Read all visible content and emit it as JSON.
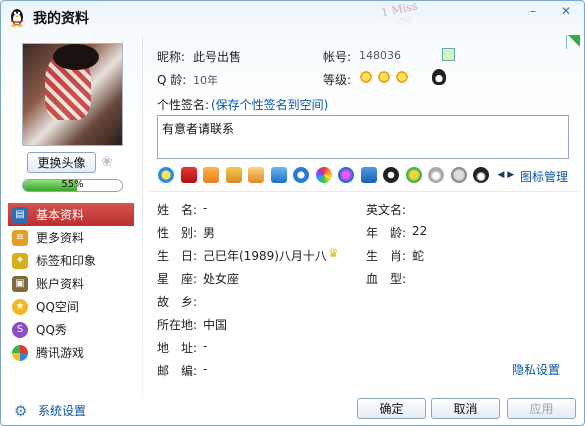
{
  "window": {
    "title": "我的资料",
    "watermark": "Miss",
    "watermark_digit": "1",
    "minimize_glyph": "–",
    "close_glyph": "✕"
  },
  "left": {
    "change_avatar_label": "更换头像",
    "completion": {
      "percent": 55,
      "label": "55%"
    },
    "nav": [
      {
        "label": "基本资料",
        "icon": "basic-info-icon",
        "active": true
      },
      {
        "label": "更多资料",
        "icon": "more-info-icon",
        "active": false
      },
      {
        "label": "标签和印象",
        "icon": "tags-impression-icon",
        "active": false
      },
      {
        "label": "账户资料",
        "icon": "account-info-icon",
        "active": false
      },
      {
        "label": "QQ空间",
        "icon": "qzone-icon",
        "active": false
      },
      {
        "label": "QQ秀",
        "icon": "qqshow-icon",
        "active": false
      },
      {
        "label": "腾讯游戏",
        "icon": "tencent-games-icon",
        "active": false
      }
    ],
    "settings_label": "系统设置"
  },
  "profile": {
    "nickname_label": "昵称:",
    "nickname_value": "此号出售",
    "account_label": "帐号:",
    "account_value": "148036",
    "qage_label": "Q 龄:",
    "qage_value": "10年",
    "level_label": "等级:",
    "signature_label": "个性签名:",
    "signature_link": "(保存个性签名到空间)",
    "signature_text": "有意者请联系",
    "icon_manage_label": "图标管理"
  },
  "details": {
    "left": [
      {
        "label": "姓　名:",
        "value": "-"
      },
      {
        "label": "性　别:",
        "value": "男"
      },
      {
        "label": "生　日:",
        "value": "己巳年(1989)八月十八"
      },
      {
        "label": "星　座:",
        "value": "处女座"
      },
      {
        "label": "故　乡:",
        "value": ""
      },
      {
        "label": "所在地:",
        "value": "中国"
      },
      {
        "label": "地　址:",
        "value": "-"
      },
      {
        "label": "邮　编:",
        "value": "-"
      }
    ],
    "right": [
      {
        "label": "英文名:",
        "value": ""
      },
      {
        "label": "年　龄:",
        "value": "22"
      },
      {
        "label": "生　肖:",
        "value": "蛇"
      },
      {
        "label": "血　型:",
        "value": ""
      }
    ]
  },
  "privacy_label": "隐私设置",
  "buttons": {
    "ok": "确定",
    "cancel": "取消",
    "apply": "应用"
  },
  "colors": {
    "accent_link": "#0a56a8",
    "active_nav": "#c43d3b",
    "progress": "#3aa42a"
  },
  "badge_icons": [
    "yellow-diamond-icon",
    "red-star-icon",
    "orange-gift-icon",
    "folder-icon",
    "pencil-card-icon",
    "blue-square-icon",
    "search-star-icon",
    "rainbow-icon",
    "music-ball-icon",
    "book-icon",
    "penguin-badge-icon",
    "fruit-icon",
    "heart-icon",
    "smiley-icon",
    "penguin-icon"
  ]
}
